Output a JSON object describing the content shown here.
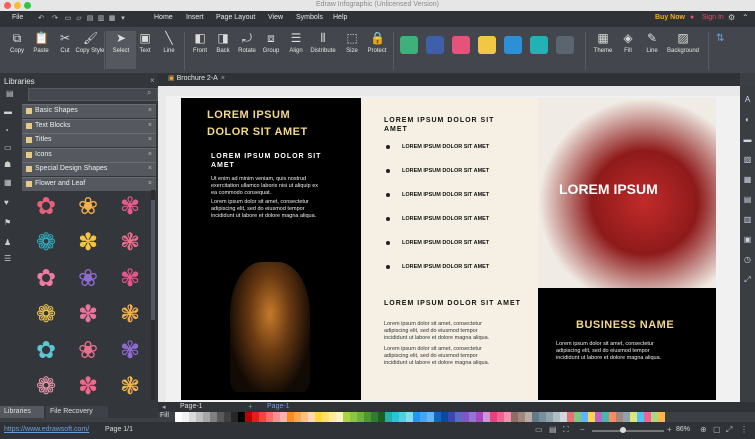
{
  "window": {
    "title": "Edraw Infographic (Unlicensed Version)"
  },
  "menubar": {
    "file": "File",
    "home": "Home",
    "insert": "Insert",
    "page_layout": "Page Layout",
    "view": "View",
    "symbols": "Symbols",
    "help": "Help",
    "buy_now": "Buy Now",
    "sign_in": "Sign In"
  },
  "ribbon": {
    "copy": "Copy",
    "paste": "Paste",
    "cut": "Cut",
    "copy_style": "Copy Style",
    "select": "Select",
    "text": "Text",
    "line": "Line",
    "front": "Front",
    "back": "Back",
    "rotate": "Rotate",
    "group": "Group",
    "align": "Align",
    "distribute": "Distribute",
    "size": "Size",
    "protect": "Protect",
    "theme": "Theme",
    "fill": "Fill",
    "line2": "Line",
    "background": "Background",
    "style_colors": [
      "#3fb07c",
      "#3f5fa8",
      "#e6537a",
      "#f2c744",
      "#2d8fd6",
      "#22b2b5",
      "#5b6570"
    ]
  },
  "libraries": {
    "title": "Libraries",
    "categories": [
      "Basic Shapes",
      "Text Blocks",
      "Titles",
      "Icons",
      "Special Design Shapes",
      "Flower and Leaf"
    ],
    "bottom_tabs": [
      "Libraries",
      "File Recovery"
    ]
  },
  "document": {
    "tab": "Brochure 2-A",
    "col1": {
      "heading_line1": "LOREM IPSUM",
      "heading_line2": "DOLOR SIT AMET",
      "sub_line1": "LOREM IPSUM DOLOR SIT",
      "sub_line2": "AMET",
      "para1": [
        "Ut enim ad minim veniam, quis nostrud",
        "exercitation ullamco laboris nisi ut aliquip ex",
        "ea commodo consequat."
      ],
      "para2": [
        "Lorem ipsum dolor sit amet, consectetur",
        "adipiscing elit, sed do eiusmod tempor",
        "incididunt ut labore et dolore magna aliqua."
      ]
    },
    "col2": {
      "heading_line1": "LOREM IPSUM DOLOR SIT",
      "heading_line2": "AMET",
      "bullets": [
        "LOREM IPSUM DOLOR SIT AMET",
        "LOREM IPSUM DOLOR SIT AMET",
        "LOREM IPSUM DOLOR SIT AMET",
        "LOREM IPSUM DOLOR SIT AMET",
        "LOREM IPSUM DOLOR SIT AMET",
        "LOREM IPSUM DOLOR SIT AMET"
      ],
      "heading2": "LOREM IPSUM DOLOR SIT AMET",
      "para1": [
        "Lorem ipsum dolor sit amet, consectetur",
        "adipiscing elit, sed do eiusmod tempor",
        "incididunt ut labore et dolore magna aliqua."
      ],
      "para2": [
        "Lorem ipsum dolor sit amet, consectetur",
        "adipiscing elit, sed do eiusmod tempor",
        "incididunt ut labore et dolore magna aliqua."
      ]
    },
    "col3": {
      "overlay": "LOREM IPSUM",
      "business": "BUSINESS NAME",
      "para": [
        "Lorem ipsum dolor sit amet, consectetur",
        "adipiscing elit, sed do eiusmod tempor",
        "incididunt ut labore et dolore magna aliqua."
      ]
    }
  },
  "pages": {
    "tab": "Page-1",
    "current": "Page-1",
    "fill_label": "Fill"
  },
  "status": {
    "url": "https://www.edrawsoft.com/",
    "page": "Page 1/1",
    "zoom": "86%"
  },
  "palette": [
    "#ffffff",
    "#f2f2f2",
    "#d9d9d9",
    "#bfbfbf",
    "#a6a6a6",
    "#808080",
    "#595959",
    "#404040",
    "#262626",
    "#000000",
    "#c00000",
    "#e02020",
    "#ff4040",
    "#ff6a6a",
    "#ff9090",
    "#ffb3b3",
    "#ff8c1a",
    "#ffa64d",
    "#ffbf80",
    "#ffd9b3",
    "#ffd633",
    "#ffe066",
    "#ffeb99",
    "#fff2c2",
    "#a8d640",
    "#8cc63f",
    "#6fb33a",
    "#4c9a2a",
    "#2e7d32",
    "#1b5e20",
    "#20b2aa",
    "#26c6da",
    "#4dd0e1",
    "#80deea",
    "#2196f3",
    "#42a5f5",
    "#64b5f6",
    "#1565c0",
    "#0d47a1",
    "#3949ab",
    "#5c6bc0",
    "#7e57c2",
    "#9575cd",
    "#ab47bc",
    "#ce93d8",
    "#ec407a",
    "#f06292",
    "#f48fb1",
    "#8d6e63",
    "#a1887f",
    "#bcaaa4",
    "#607d8b",
    "#78909c",
    "#90a4ae",
    "#b0bec5",
    "#cfd8dc",
    "#e57373",
    "#81c784",
    "#64b5f6",
    "#ffd54f",
    "#ba68c8",
    "#4db6ac",
    "#ff8a65",
    "#a1887f",
    "#90a4ae",
    "#dce775",
    "#4fc3f7",
    "#f06292",
    "#aed581",
    "#ffb74d"
  ],
  "flowers": [
    "#e8617a",
    "#f5b04a",
    "#e85a8c",
    "#2ab3c5",
    "#f4c542",
    "#ec6f8b",
    "#f07aa2",
    "#8f6ad2",
    "#e8558a",
    "#f7c84b",
    "#e9739b",
    "#f5b04a",
    "#5cc6d3",
    "#ec6f8b",
    "#8f6ad2",
    "#f29ab0",
    "#e96a8a",
    "#f2b54d"
  ]
}
